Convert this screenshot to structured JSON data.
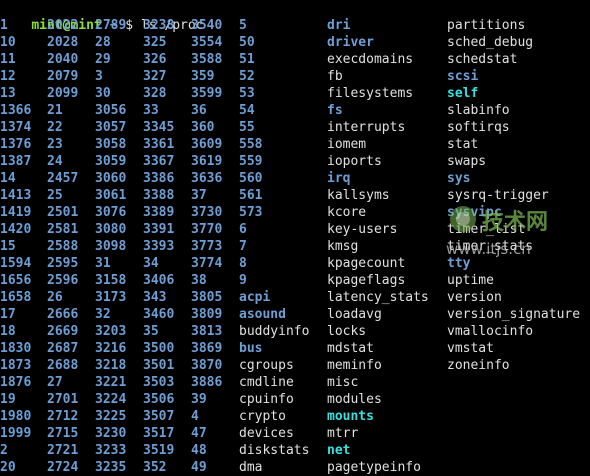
{
  "prompt": {
    "user_host": "mint@mint",
    "path": "~",
    "symbol": "$",
    "command": "ls /proc"
  },
  "colors": {
    "dir": "#6c9fd6",
    "file": "#e0e0e0",
    "link": "#34e2e2",
    "prompt_user": "#8ae234"
  },
  "columns": [
    [
      {
        "t": "1",
        "k": "d"
      },
      {
        "t": "10",
        "k": "d"
      },
      {
        "t": "11",
        "k": "d"
      },
      {
        "t": "12",
        "k": "d"
      },
      {
        "t": "13",
        "k": "d"
      },
      {
        "t": "1366",
        "k": "d"
      },
      {
        "t": "1374",
        "k": "d"
      },
      {
        "t": "1376",
        "k": "d"
      },
      {
        "t": "1387",
        "k": "d"
      },
      {
        "t": "14",
        "k": "d"
      },
      {
        "t": "1413",
        "k": "d"
      },
      {
        "t": "1419",
        "k": "d"
      },
      {
        "t": "1420",
        "k": "d"
      },
      {
        "t": "15",
        "k": "d"
      },
      {
        "t": "1594",
        "k": "d"
      },
      {
        "t": "1656",
        "k": "d"
      },
      {
        "t": "1658",
        "k": "d"
      },
      {
        "t": "17",
        "k": "d"
      },
      {
        "t": "18",
        "k": "d"
      },
      {
        "t": "1830",
        "k": "d"
      },
      {
        "t": "1873",
        "k": "d"
      },
      {
        "t": "1876",
        "k": "d"
      },
      {
        "t": "19",
        "k": "d"
      },
      {
        "t": "1980",
        "k": "d"
      },
      {
        "t": "1999",
        "k": "d"
      },
      {
        "t": "2",
        "k": "d"
      },
      {
        "t": "20",
        "k": "d"
      }
    ],
    [
      {
        "t": "2022",
        "k": "d"
      },
      {
        "t": "2028",
        "k": "d"
      },
      {
        "t": "2040",
        "k": "d"
      },
      {
        "t": "2079",
        "k": "d"
      },
      {
        "t": "2099",
        "k": "d"
      },
      {
        "t": "21",
        "k": "d"
      },
      {
        "t": "22",
        "k": "d"
      },
      {
        "t": "23",
        "k": "d"
      },
      {
        "t": "24",
        "k": "d"
      },
      {
        "t": "2457",
        "k": "d"
      },
      {
        "t": "25",
        "k": "d"
      },
      {
        "t": "2501",
        "k": "d"
      },
      {
        "t": "2581",
        "k": "d"
      },
      {
        "t": "2588",
        "k": "d"
      },
      {
        "t": "2595",
        "k": "d"
      },
      {
        "t": "2596",
        "k": "d"
      },
      {
        "t": "26",
        "k": "d"
      },
      {
        "t": "2666",
        "k": "d"
      },
      {
        "t": "2669",
        "k": "d"
      },
      {
        "t": "2687",
        "k": "d"
      },
      {
        "t": "2688",
        "k": "d"
      },
      {
        "t": "27",
        "k": "d"
      },
      {
        "t": "2701",
        "k": "d"
      },
      {
        "t": "2712",
        "k": "d"
      },
      {
        "t": "2715",
        "k": "d"
      },
      {
        "t": "2721",
        "k": "d"
      },
      {
        "t": "2724",
        "k": "d"
      }
    ],
    [
      {
        "t": "2789",
        "k": "d"
      },
      {
        "t": "28",
        "k": "d"
      },
      {
        "t": "29",
        "k": "d"
      },
      {
        "t": "3",
        "k": "d"
      },
      {
        "t": "30",
        "k": "d"
      },
      {
        "t": "3056",
        "k": "d"
      },
      {
        "t": "3057",
        "k": "d"
      },
      {
        "t": "3058",
        "k": "d"
      },
      {
        "t": "3059",
        "k": "d"
      },
      {
        "t": "3060",
        "k": "d"
      },
      {
        "t": "3061",
        "k": "d"
      },
      {
        "t": "3076",
        "k": "d"
      },
      {
        "t": "3080",
        "k": "d"
      },
      {
        "t": "3098",
        "k": "d"
      },
      {
        "t": "31",
        "k": "d"
      },
      {
        "t": "3158",
        "k": "d"
      },
      {
        "t": "3173",
        "k": "d"
      },
      {
        "t": "32",
        "k": "d"
      },
      {
        "t": "3203",
        "k": "d"
      },
      {
        "t": "3216",
        "k": "d"
      },
      {
        "t": "3218",
        "k": "d"
      },
      {
        "t": "3221",
        "k": "d"
      },
      {
        "t": "3224",
        "k": "d"
      },
      {
        "t": "3225",
        "k": "d"
      },
      {
        "t": "3230",
        "k": "d"
      },
      {
        "t": "3233",
        "k": "d"
      },
      {
        "t": "3235",
        "k": "d"
      }
    ],
    [
      {
        "t": "3238",
        "k": "d"
      },
      {
        "t": "325",
        "k": "d"
      },
      {
        "t": "326",
        "k": "d"
      },
      {
        "t": "327",
        "k": "d"
      },
      {
        "t": "328",
        "k": "d"
      },
      {
        "t": "33",
        "k": "d"
      },
      {
        "t": "3345",
        "k": "d"
      },
      {
        "t": "3361",
        "k": "d"
      },
      {
        "t": "3367",
        "k": "d"
      },
      {
        "t": "3386",
        "k": "d"
      },
      {
        "t": "3388",
        "k": "d"
      },
      {
        "t": "3389",
        "k": "d"
      },
      {
        "t": "3391",
        "k": "d"
      },
      {
        "t": "3393",
        "k": "d"
      },
      {
        "t": "34",
        "k": "d"
      },
      {
        "t": "3406",
        "k": "d"
      },
      {
        "t": "343",
        "k": "d"
      },
      {
        "t": "3460",
        "k": "d"
      },
      {
        "t": "35",
        "k": "d"
      },
      {
        "t": "3500",
        "k": "d"
      },
      {
        "t": "3501",
        "k": "d"
      },
      {
        "t": "3503",
        "k": "d"
      },
      {
        "t": "3506",
        "k": "d"
      },
      {
        "t": "3507",
        "k": "d"
      },
      {
        "t": "3517",
        "k": "d"
      },
      {
        "t": "3519",
        "k": "d"
      },
      {
        "t": "352",
        "k": "d"
      }
    ],
    [
      {
        "t": "3540",
        "k": "d"
      },
      {
        "t": "3554",
        "k": "d"
      },
      {
        "t": "3588",
        "k": "d"
      },
      {
        "t": "359",
        "k": "d"
      },
      {
        "t": "3599",
        "k": "d"
      },
      {
        "t": "36",
        "k": "d"
      },
      {
        "t": "360",
        "k": "d"
      },
      {
        "t": "3609",
        "k": "d"
      },
      {
        "t": "3619",
        "k": "d"
      },
      {
        "t": "3636",
        "k": "d"
      },
      {
        "t": "37",
        "k": "d"
      },
      {
        "t": "3730",
        "k": "d"
      },
      {
        "t": "3770",
        "k": "d"
      },
      {
        "t": "3773",
        "k": "d"
      },
      {
        "t": "3774",
        "k": "d"
      },
      {
        "t": "38",
        "k": "d"
      },
      {
        "t": "3805",
        "k": "d"
      },
      {
        "t": "3809",
        "k": "d"
      },
      {
        "t": "3813",
        "k": "d"
      },
      {
        "t": "3869",
        "k": "d"
      },
      {
        "t": "3870",
        "k": "d"
      },
      {
        "t": "3886",
        "k": "d"
      },
      {
        "t": "39",
        "k": "d"
      },
      {
        "t": "4",
        "k": "d"
      },
      {
        "t": "47",
        "k": "d"
      },
      {
        "t": "48",
        "k": "d"
      },
      {
        "t": "49",
        "k": "d"
      }
    ],
    [
      {
        "t": "5",
        "k": "d"
      },
      {
        "t": "50",
        "k": "d"
      },
      {
        "t": "51",
        "k": "d"
      },
      {
        "t": "52",
        "k": "d"
      },
      {
        "t": "53",
        "k": "d"
      },
      {
        "t": "54",
        "k": "d"
      },
      {
        "t": "55",
        "k": "d"
      },
      {
        "t": "558",
        "k": "d"
      },
      {
        "t": "559",
        "k": "d"
      },
      {
        "t": "560",
        "k": "d"
      },
      {
        "t": "561",
        "k": "d"
      },
      {
        "t": "573",
        "k": "d"
      },
      {
        "t": "6",
        "k": "d"
      },
      {
        "t": "7",
        "k": "d"
      },
      {
        "t": "8",
        "k": "d"
      },
      {
        "t": "9",
        "k": "d"
      },
      {
        "t": "acpi",
        "k": "d"
      },
      {
        "t": "asound",
        "k": "d"
      },
      {
        "t": "buddyinfo",
        "k": "f"
      },
      {
        "t": "bus",
        "k": "d"
      },
      {
        "t": "cgroups",
        "k": "f"
      },
      {
        "t": "cmdline",
        "k": "f"
      },
      {
        "t": "cpuinfo",
        "k": "f"
      },
      {
        "t": "crypto",
        "k": "f"
      },
      {
        "t": "devices",
        "k": "f"
      },
      {
        "t": "diskstats",
        "k": "f"
      },
      {
        "t": "dma",
        "k": "f"
      }
    ],
    [
      {
        "t": "dri",
        "k": "d"
      },
      {
        "t": "driver",
        "k": "d"
      },
      {
        "t": "execdomains",
        "k": "f"
      },
      {
        "t": "fb",
        "k": "f"
      },
      {
        "t": "filesystems",
        "k": "f"
      },
      {
        "t": "fs",
        "k": "d"
      },
      {
        "t": "interrupts",
        "k": "f"
      },
      {
        "t": "iomem",
        "k": "f"
      },
      {
        "t": "ioports",
        "k": "f"
      },
      {
        "t": "irq",
        "k": "d"
      },
      {
        "t": "kallsyms",
        "k": "f"
      },
      {
        "t": "kcore",
        "k": "f"
      },
      {
        "t": "key-users",
        "k": "f"
      },
      {
        "t": "kmsg",
        "k": "f"
      },
      {
        "t": "kpagecount",
        "k": "f"
      },
      {
        "t": "kpageflags",
        "k": "f"
      },
      {
        "t": "latency_stats",
        "k": "f"
      },
      {
        "t": "loadavg",
        "k": "f"
      },
      {
        "t": "locks",
        "k": "f"
      },
      {
        "t": "mdstat",
        "k": "f"
      },
      {
        "t": "meminfo",
        "k": "f"
      },
      {
        "t": "misc",
        "k": "f"
      },
      {
        "t": "modules",
        "k": "f"
      },
      {
        "t": "mounts",
        "k": "l"
      },
      {
        "t": "mtrr",
        "k": "f"
      },
      {
        "t": "net",
        "k": "l"
      },
      {
        "t": "pagetypeinfo",
        "k": "f"
      }
    ],
    [
      {
        "t": "partitions",
        "k": "f"
      },
      {
        "t": "sched_debug",
        "k": "f"
      },
      {
        "t": "schedstat",
        "k": "f"
      },
      {
        "t": "scsi",
        "k": "d"
      },
      {
        "t": "self",
        "k": "l"
      },
      {
        "t": "slabinfo",
        "k": "f"
      },
      {
        "t": "softirqs",
        "k": "f"
      },
      {
        "t": "stat",
        "k": "f"
      },
      {
        "t": "swaps",
        "k": "f"
      },
      {
        "t": "sys",
        "k": "d"
      },
      {
        "t": "sysrq-trigger",
        "k": "f"
      },
      {
        "t": "sysvipc",
        "k": "d"
      },
      {
        "t": "timer_list",
        "k": "f"
      },
      {
        "t": "timer_stats",
        "k": "f"
      },
      {
        "t": "tty",
        "k": "d"
      },
      {
        "t": "uptime",
        "k": "f"
      },
      {
        "t": "version",
        "k": "f"
      },
      {
        "t": "version_signature",
        "k": "f"
      },
      {
        "t": "vmallocinfo",
        "k": "f"
      },
      {
        "t": "vmstat",
        "k": "f"
      },
      {
        "t": "zoneinfo",
        "k": "f"
      }
    ]
  ],
  "watermark": {
    "brand": "技术网",
    "url": "www.itjs.cn"
  }
}
